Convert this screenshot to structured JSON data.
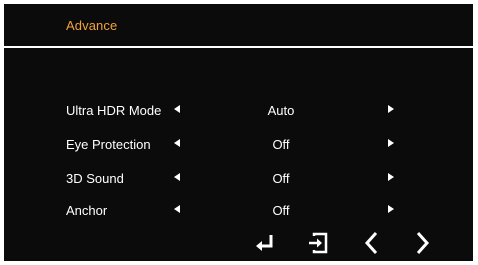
{
  "menu": {
    "title": "Advance",
    "colors": {
      "background": "#0b0b0b",
      "title": "#f0a23a",
      "text": "#ffffff"
    },
    "rows": [
      {
        "label": "Ultra HDR Mode",
        "value": "Auto"
      },
      {
        "label": "Eye Protection",
        "value": "Off"
      },
      {
        "label": "3D Sound",
        "value": "Off"
      },
      {
        "label": "Anchor",
        "value": "Off"
      }
    ]
  },
  "navbar": {
    "buttons": [
      {
        "icon": "enter-icon"
      },
      {
        "icon": "exit-icon"
      },
      {
        "icon": "chevron-left-icon"
      },
      {
        "icon": "chevron-right-icon"
      }
    ]
  }
}
